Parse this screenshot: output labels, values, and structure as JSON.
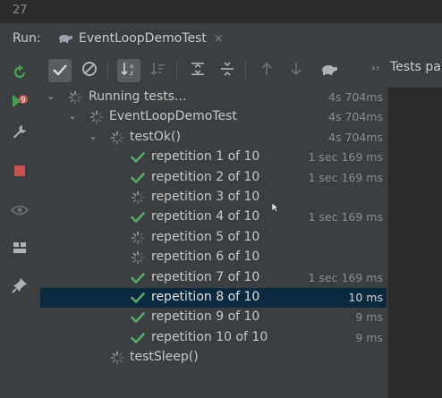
{
  "top": {
    "line_number": "27"
  },
  "run_bar": {
    "label": "Run:",
    "tab_title": "EventLoopDemoTest",
    "close_glyph": "×"
  },
  "toolbar": {
    "buttons": [
      {
        "icon": "check-icon",
        "active": true
      },
      {
        "icon": "stop-circle-icon",
        "active": false
      },
      {
        "icon": "sort-alpha-icon",
        "active": true
      },
      {
        "icon": "sort-duration-icon",
        "active": false
      },
      {
        "icon": "expand-all-icon",
        "active": false
      },
      {
        "icon": "collapse-all-icon",
        "active": false
      },
      {
        "icon": "arrow-up-icon",
        "active": false
      },
      {
        "icon": "arrow-down-icon",
        "active": false
      },
      {
        "icon": "turtle-icon",
        "active": false
      }
    ],
    "more_glyph": "››",
    "tests_label": "Tests pa"
  },
  "left_bar": [
    {
      "icon": "rerun-icon"
    },
    {
      "icon": "rerun-failed-icon"
    },
    {
      "icon": "wrench-icon"
    },
    {
      "icon": "stop-icon"
    },
    {
      "icon": "eye-icon"
    },
    {
      "icon": "layout-icon"
    },
    {
      "icon": "pin-icon"
    }
  ],
  "tree": [
    {
      "label": "Running tests...",
      "duration": "4s 704ms",
      "status": "running",
      "level": 0,
      "expanded": true
    },
    {
      "label": "EventLoopDemoTest",
      "duration": "4s 704ms",
      "status": "running",
      "level": 1,
      "expanded": true
    },
    {
      "label": "testOk()",
      "duration": "4s 704ms",
      "status": "running",
      "level": 2,
      "expanded": true
    },
    {
      "label": "repetition 1 of 10",
      "duration": "1 sec 169 ms",
      "status": "passed",
      "level": 3
    },
    {
      "label": "repetition 2 of 10",
      "duration": "1 sec 169 ms",
      "status": "passed",
      "level": 3
    },
    {
      "label": "repetition 3 of 10",
      "duration": "",
      "status": "running",
      "level": 3
    },
    {
      "label": "repetition 4 of 10",
      "duration": "1 sec 169 ms",
      "status": "passed",
      "level": 3
    },
    {
      "label": "repetition 5 of 10",
      "duration": "",
      "status": "running",
      "level": 3
    },
    {
      "label": "repetition 6 of 10",
      "duration": "",
      "status": "running",
      "level": 3
    },
    {
      "label": "repetition 7 of 10",
      "duration": "1 sec 169 ms",
      "status": "passed",
      "level": 3
    },
    {
      "label": "repetition 8 of 10",
      "duration": "10 ms",
      "status": "passed",
      "level": 3,
      "selected": true
    },
    {
      "label": "repetition 9 of 10",
      "duration": "9 ms",
      "status": "passed",
      "level": 3
    },
    {
      "label": "repetition 10 of 10",
      "duration": "9 ms",
      "status": "passed",
      "level": 3
    },
    {
      "label": "testSleep()",
      "duration": "",
      "status": "running",
      "level": 2
    }
  ],
  "colors": {
    "background": "#3c3f41",
    "console": "#2b2b2b",
    "selected_row": "#0d293e",
    "passed_check": "#59a869",
    "stop_red": "#c75450",
    "rerun_green": "#499c54"
  }
}
